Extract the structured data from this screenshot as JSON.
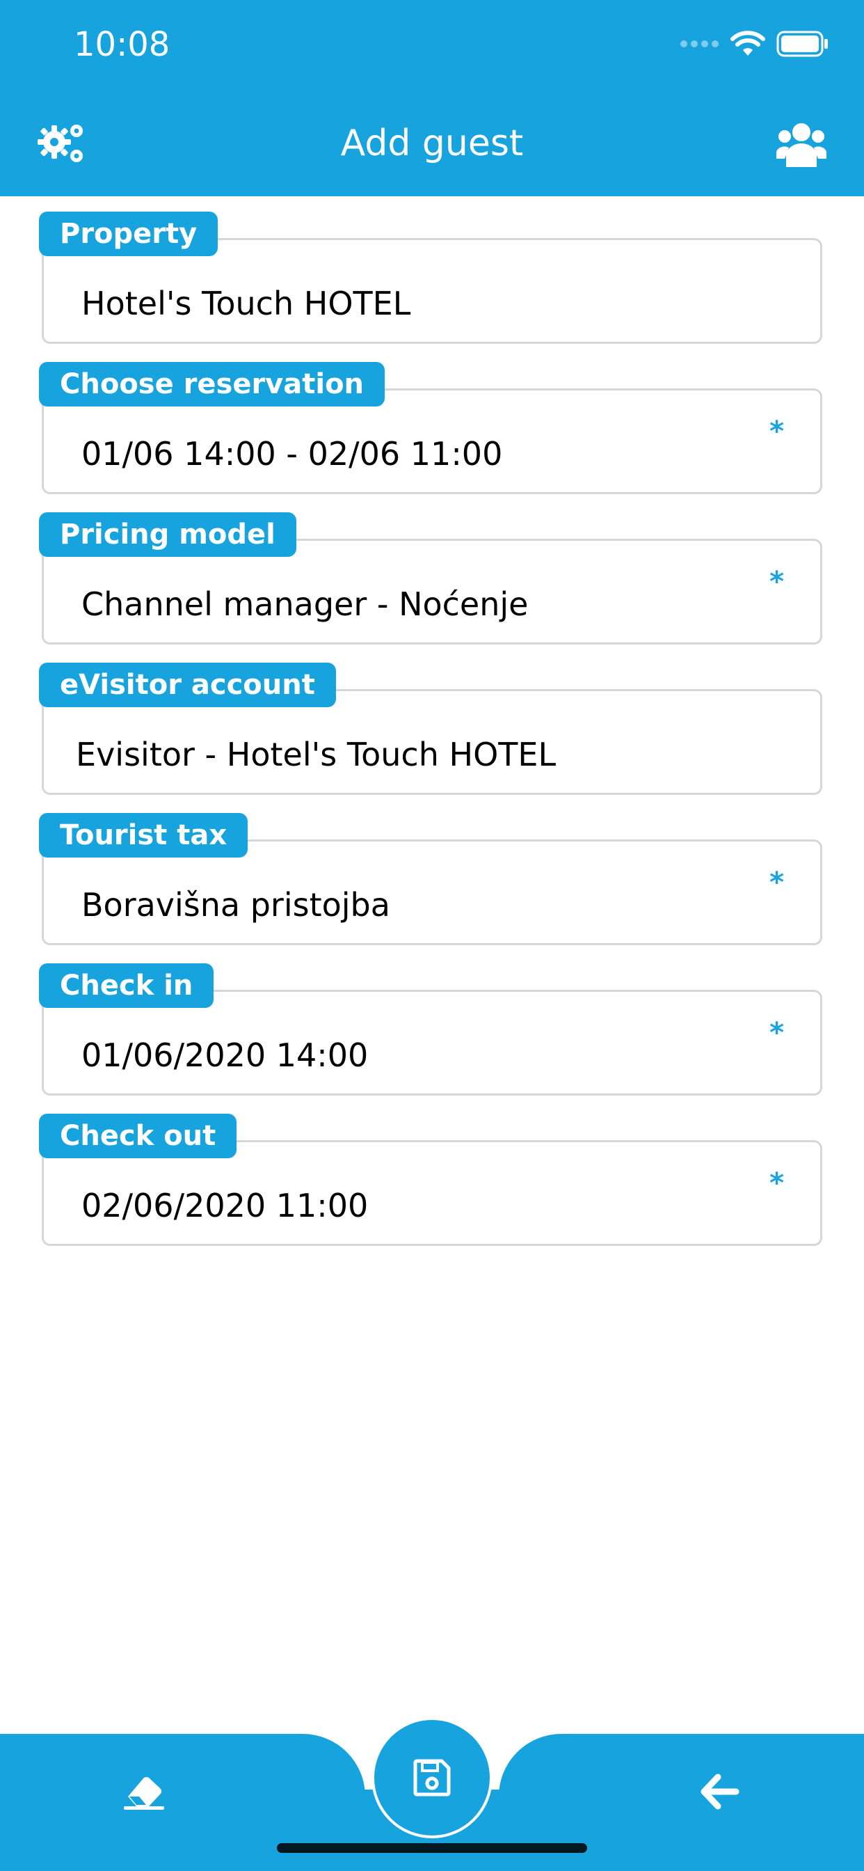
{
  "status_bar": {
    "time": "10:08"
  },
  "header": {
    "title": "Add guest",
    "left_icon": "settings-gears-icon",
    "right_icon": "users-group-icon"
  },
  "fields": [
    {
      "label": "Property",
      "value": "Hotel's Touch HOTEL",
      "required": ""
    },
    {
      "label": "Choose reservation",
      "value": "01/06 14:00 - 02/06 11:00",
      "required": "*"
    },
    {
      "label": "Pricing model",
      "value": "Channel manager  - Noćenje",
      "required": "*"
    },
    {
      "label": "eVisitor account",
      "value": "Evisitor - Hotel's Touch HOTEL",
      "required": ""
    },
    {
      "label": "Tourist tax",
      "value": "Boravišna pristojba",
      "required": "*"
    },
    {
      "label": "Check in",
      "value": "01/06/2020 14:00",
      "required": "*"
    },
    {
      "label": "Check out",
      "value": "02/06/2020 11:00",
      "required": "*"
    }
  ],
  "bottom_bar": {
    "left_icon": "eraser-icon",
    "center_icon": "save-icon",
    "right_icon": "arrow-left-icon"
  },
  "colors": {
    "accent": "#17a3dd",
    "field_border": "#d6d6d6",
    "text": "#000000"
  }
}
